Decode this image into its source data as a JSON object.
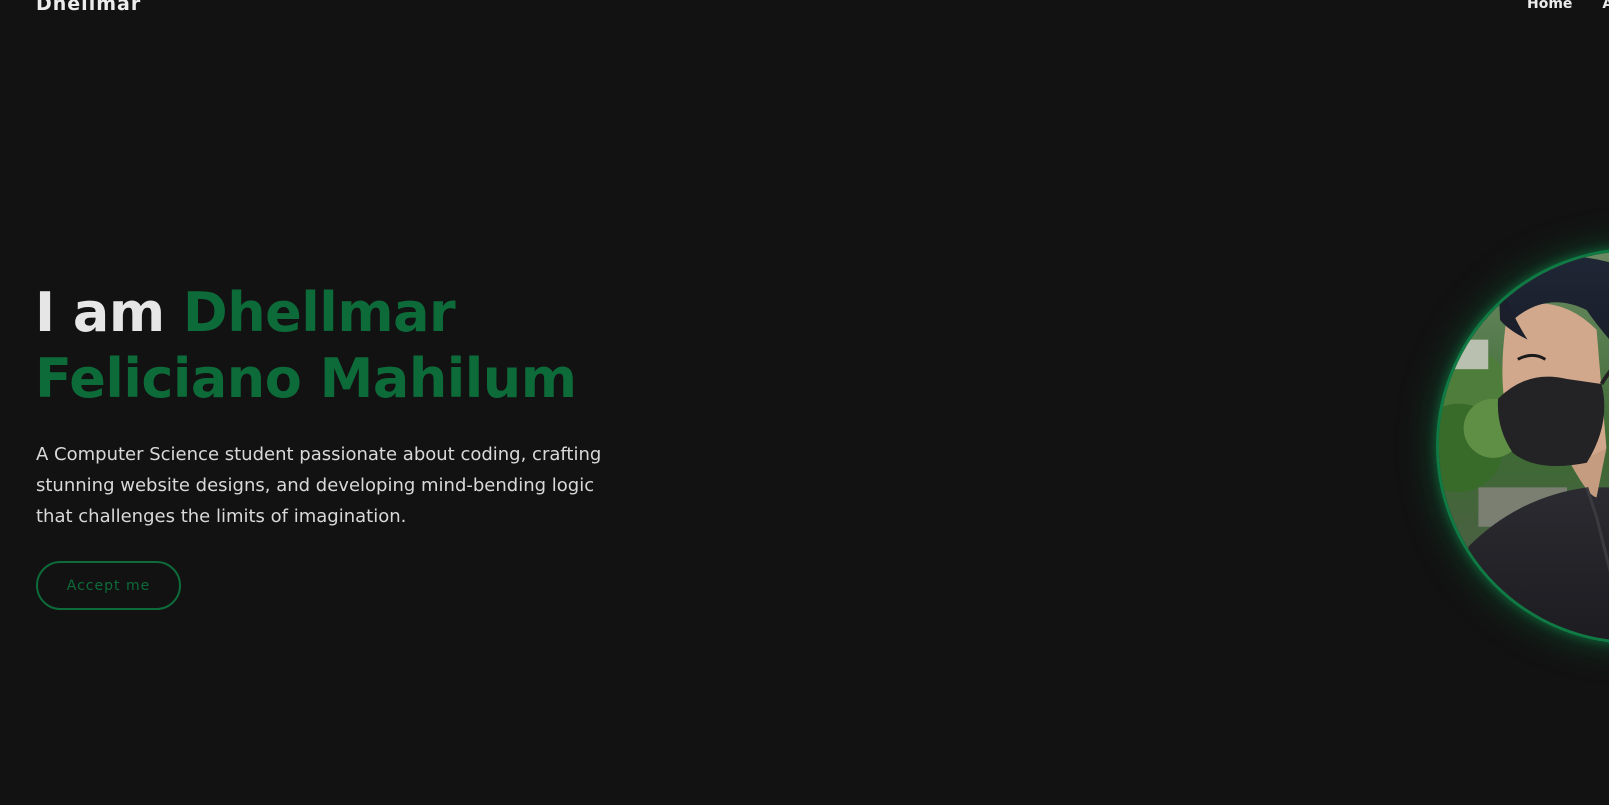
{
  "nav": {
    "logo": "Dhellmar",
    "links": [
      {
        "label": "Home"
      },
      {
        "label": "A"
      }
    ]
  },
  "hero": {
    "title_prefix": "I am ",
    "title_name": "Dhellmar Feliciano Mahilum",
    "description": "A Computer Science student passionate about coding, crafting stunning website designs, and developing mind-bending logic that challenges the limits of imagination.",
    "cta_label": "Accept me"
  },
  "colors": {
    "background": "#121212",
    "accent": "#0d6b3a",
    "text": "#e6e6e6"
  }
}
